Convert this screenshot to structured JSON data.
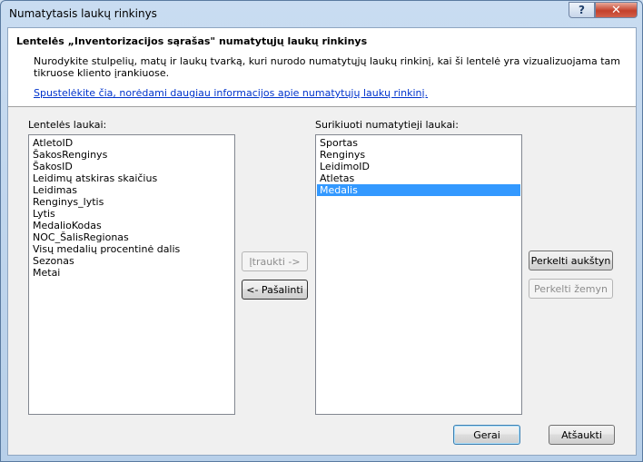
{
  "window": {
    "title": "Numatytasis laukų rinkinys"
  },
  "titlebar": {
    "help_glyph": "?",
    "close_glyph": "✕"
  },
  "header": {
    "title": "Lentelės „Inventorizacijos sąrašas\" numatytųjų laukų rinkinys",
    "description": "Nurodykite stulpelių, matų ir laukų tvarką, kuri nurodo numatytųjų laukų rinkinį, kai ši lentelė yra vizualizuojama tam tikruose kliento įrankiuose.",
    "link": "Spustelėkite čia, norėdami daugiau informacijos apie numatytųjų laukų rinkinį."
  },
  "table_fields": {
    "label": "Lentelės laukai:",
    "items": [
      "AtletoID",
      "ŠakosRenginys",
      "ŠakosID",
      "Leidimų atskiras skaičius",
      "Leidimas",
      "Renginys_lytis",
      "Lytis",
      "MedalioKodas",
      "NOC_ŠalisRegionas",
      "Visų medalių procentinė dalis",
      "Sezonas",
      "Metai"
    ]
  },
  "sorted_fields": {
    "label": "Surikiuoti numatytieji laukai:",
    "items": [
      "Sportas",
      "Renginys",
      "LeidimoID",
      "Atletas",
      "Medalis"
    ],
    "selected": "Medalis"
  },
  "buttons": {
    "add": "Įtraukti ->",
    "remove": "<- Pašalinti",
    "move_up": "Perkelti aukštyn",
    "move_down": "Perkelti žemyn",
    "ok": "Gerai",
    "cancel": "Atšaukti"
  }
}
